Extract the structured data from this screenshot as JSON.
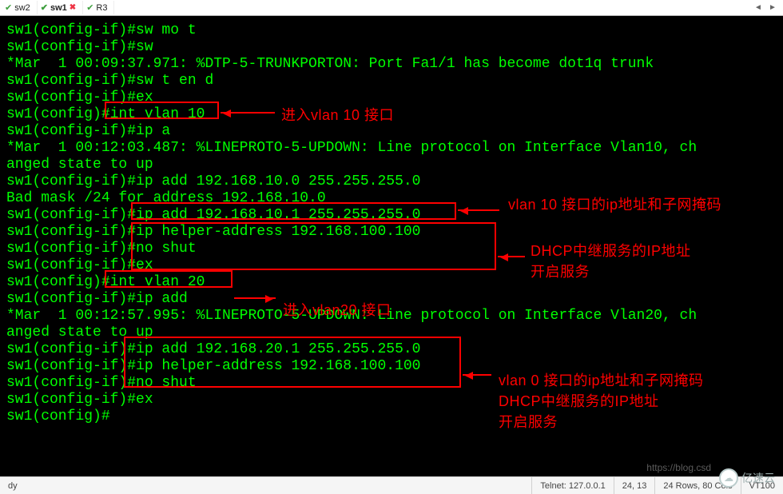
{
  "tabs": [
    {
      "label": "sw2",
      "status": "check"
    },
    {
      "label": "sw1",
      "status": "check",
      "active": true,
      "closable": true
    },
    {
      "label": "R3",
      "status": "check"
    }
  ],
  "terminal_lines": [
    "sw1(config-if)#sw mo t",
    "sw1(config-if)#sw",
    "*Mar  1 00:09:37.971: %DTP-5-TRUNKPORTON: Port Fa1/1 has become dot1q trunk",
    "sw1(config-if)#sw t en d",
    "sw1(config-if)#ex",
    "sw1(config)#int vlan 10",
    "sw1(config-if)#ip a",
    "*Mar  1 00:12:03.487: %LINEPROTO-5-UPDOWN: Line protocol on Interface Vlan10, ch",
    "anged state to up",
    "sw1(config-if)#ip add 192.168.10.0 255.255.255.0",
    "Bad mask /24 for address 192.168.10.0",
    "sw1(config-if)#ip add 192.168.10.1 255.255.255.0",
    "sw1(config-if)#ip helper-address 192.168.100.100",
    "sw1(config-if)#no shut",
    "sw1(config-if)#ex",
    "sw1(config)#int vlan 20",
    "sw1(config-if)#ip add",
    "*Mar  1 00:12:57.995: %LINEPROTO-5-UPDOWN: Line protocol on Interface Vlan20, ch",
    "anged state to up",
    "sw1(config-if)#ip add 192.168.20.1 255.255.255.0",
    "sw1(config-if)#ip helper-address 192.168.100.100",
    "sw1(config-if)#no shut",
    "sw1(config-if)#ex",
    "sw1(config)#"
  ],
  "annotations": {
    "label1": "进入vlan 10 接口",
    "label2": "vlan 10 接口的ip地址和子网掩码",
    "label3a": "DHCP中继服务的IP地址",
    "label3b": "开启服务",
    "label4": "进入vlan20 接口",
    "label5a": "vlan 0 接口的ip地址和子网掩码",
    "label5b": "DHCP中继服务的IP地址",
    "label5c": "开启服务"
  },
  "status": {
    "left": "dy",
    "telnet": "Telnet: 127.0.0.1",
    "cursor": "24, 13",
    "size": "24 Rows, 80 Cols",
    "term": "VT100"
  },
  "watermark1": "https://blog.csd",
  "watermark2": "亿速云"
}
